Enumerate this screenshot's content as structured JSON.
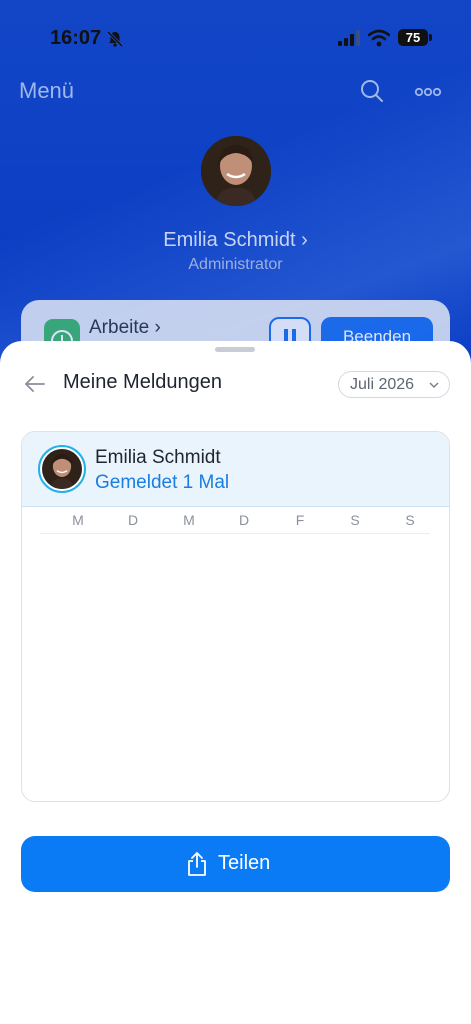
{
  "status_bar": {
    "time": "16:07",
    "battery": "75"
  },
  "header": {
    "title": "Menü"
  },
  "profile": {
    "name": "Emilia Schmidt",
    "name_chevron": "›",
    "role": "Administrator"
  },
  "work_card": {
    "label": "Arbeite",
    "label_chevron": "›",
    "end_label": "Beenden"
  },
  "sheet": {
    "title": "Meine Meldungen",
    "month": "Juli 2026"
  },
  "report": {
    "user_name": "Emilia Schmidt",
    "count_text": "Gemeldet 1 Mal",
    "weekdays": [
      "M",
      "D",
      "M",
      "D",
      "F",
      "S",
      "S"
    ]
  },
  "share_button": {
    "label": "Teilen"
  },
  "colors": {
    "accent": "#0a7bf5",
    "count_text": "#1a7de0",
    "header_bg": "#1246c6"
  },
  "icons": [
    "bell-slash-icon",
    "signal-icon",
    "wifi-icon",
    "battery-icon",
    "search-icon",
    "more-icon",
    "back-arrow-icon",
    "chevron-down-icon",
    "share-icon",
    "clock-icon",
    "pause-icon"
  ]
}
